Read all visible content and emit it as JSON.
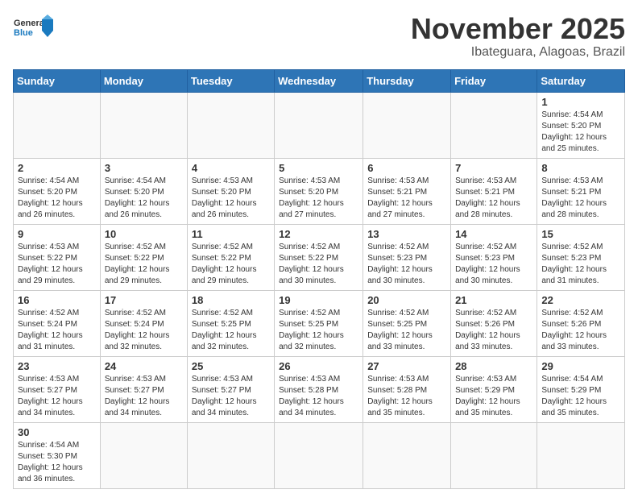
{
  "header": {
    "logo_general": "General",
    "logo_blue": "Blue",
    "month_title": "November 2025",
    "location": "Ibateguara, Alagoas, Brazil"
  },
  "weekdays": [
    "Sunday",
    "Monday",
    "Tuesday",
    "Wednesday",
    "Thursday",
    "Friday",
    "Saturday"
  ],
  "weeks": [
    [
      {
        "day": "",
        "info": ""
      },
      {
        "day": "",
        "info": ""
      },
      {
        "day": "",
        "info": ""
      },
      {
        "day": "",
        "info": ""
      },
      {
        "day": "",
        "info": ""
      },
      {
        "day": "",
        "info": ""
      },
      {
        "day": "1",
        "info": "Sunrise: 4:54 AM\nSunset: 5:20 PM\nDaylight: 12 hours and 25 minutes."
      }
    ],
    [
      {
        "day": "2",
        "info": "Sunrise: 4:54 AM\nSunset: 5:20 PM\nDaylight: 12 hours and 26 minutes."
      },
      {
        "day": "3",
        "info": "Sunrise: 4:54 AM\nSunset: 5:20 PM\nDaylight: 12 hours and 26 minutes."
      },
      {
        "day": "4",
        "info": "Sunrise: 4:53 AM\nSunset: 5:20 PM\nDaylight: 12 hours and 26 minutes."
      },
      {
        "day": "5",
        "info": "Sunrise: 4:53 AM\nSunset: 5:20 PM\nDaylight: 12 hours and 27 minutes."
      },
      {
        "day": "6",
        "info": "Sunrise: 4:53 AM\nSunset: 5:21 PM\nDaylight: 12 hours and 27 minutes."
      },
      {
        "day": "7",
        "info": "Sunrise: 4:53 AM\nSunset: 5:21 PM\nDaylight: 12 hours and 28 minutes."
      },
      {
        "day": "8",
        "info": "Sunrise: 4:53 AM\nSunset: 5:21 PM\nDaylight: 12 hours and 28 minutes."
      }
    ],
    [
      {
        "day": "9",
        "info": "Sunrise: 4:53 AM\nSunset: 5:22 PM\nDaylight: 12 hours and 29 minutes."
      },
      {
        "day": "10",
        "info": "Sunrise: 4:52 AM\nSunset: 5:22 PM\nDaylight: 12 hours and 29 minutes."
      },
      {
        "day": "11",
        "info": "Sunrise: 4:52 AM\nSunset: 5:22 PM\nDaylight: 12 hours and 29 minutes."
      },
      {
        "day": "12",
        "info": "Sunrise: 4:52 AM\nSunset: 5:22 PM\nDaylight: 12 hours and 30 minutes."
      },
      {
        "day": "13",
        "info": "Sunrise: 4:52 AM\nSunset: 5:23 PM\nDaylight: 12 hours and 30 minutes."
      },
      {
        "day": "14",
        "info": "Sunrise: 4:52 AM\nSunset: 5:23 PM\nDaylight: 12 hours and 30 minutes."
      },
      {
        "day": "15",
        "info": "Sunrise: 4:52 AM\nSunset: 5:23 PM\nDaylight: 12 hours and 31 minutes."
      }
    ],
    [
      {
        "day": "16",
        "info": "Sunrise: 4:52 AM\nSunset: 5:24 PM\nDaylight: 12 hours and 31 minutes."
      },
      {
        "day": "17",
        "info": "Sunrise: 4:52 AM\nSunset: 5:24 PM\nDaylight: 12 hours and 32 minutes."
      },
      {
        "day": "18",
        "info": "Sunrise: 4:52 AM\nSunset: 5:25 PM\nDaylight: 12 hours and 32 minutes."
      },
      {
        "day": "19",
        "info": "Sunrise: 4:52 AM\nSunset: 5:25 PM\nDaylight: 12 hours and 32 minutes."
      },
      {
        "day": "20",
        "info": "Sunrise: 4:52 AM\nSunset: 5:25 PM\nDaylight: 12 hours and 33 minutes."
      },
      {
        "day": "21",
        "info": "Sunrise: 4:52 AM\nSunset: 5:26 PM\nDaylight: 12 hours and 33 minutes."
      },
      {
        "day": "22",
        "info": "Sunrise: 4:52 AM\nSunset: 5:26 PM\nDaylight: 12 hours and 33 minutes."
      }
    ],
    [
      {
        "day": "23",
        "info": "Sunrise: 4:53 AM\nSunset: 5:27 PM\nDaylight: 12 hours and 34 minutes."
      },
      {
        "day": "24",
        "info": "Sunrise: 4:53 AM\nSunset: 5:27 PM\nDaylight: 12 hours and 34 minutes."
      },
      {
        "day": "25",
        "info": "Sunrise: 4:53 AM\nSunset: 5:27 PM\nDaylight: 12 hours and 34 minutes."
      },
      {
        "day": "26",
        "info": "Sunrise: 4:53 AM\nSunset: 5:28 PM\nDaylight: 12 hours and 34 minutes."
      },
      {
        "day": "27",
        "info": "Sunrise: 4:53 AM\nSunset: 5:28 PM\nDaylight: 12 hours and 35 minutes."
      },
      {
        "day": "28",
        "info": "Sunrise: 4:53 AM\nSunset: 5:29 PM\nDaylight: 12 hours and 35 minutes."
      },
      {
        "day": "29",
        "info": "Sunrise: 4:54 AM\nSunset: 5:29 PM\nDaylight: 12 hours and 35 minutes."
      }
    ],
    [
      {
        "day": "30",
        "info": "Sunrise: 4:54 AM\nSunset: 5:30 PM\nDaylight: 12 hours and 36 minutes."
      },
      {
        "day": "",
        "info": ""
      },
      {
        "day": "",
        "info": ""
      },
      {
        "day": "",
        "info": ""
      },
      {
        "day": "",
        "info": ""
      },
      {
        "day": "",
        "info": ""
      },
      {
        "day": "",
        "info": ""
      }
    ]
  ]
}
